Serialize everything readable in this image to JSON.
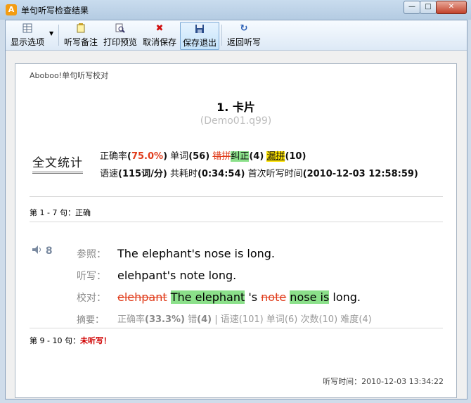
{
  "window": {
    "app_icon": "A",
    "title": "单句听写检查结果",
    "min_symbol": "—",
    "max_symbol": "□",
    "close_symbol": "✕"
  },
  "toolbar": {
    "show_options": "显示选项",
    "dictation_note": "听写备注",
    "print_preview": "打印预览",
    "cancel_save": "取消保存",
    "save_exit": "保存退出",
    "return_dictation": "返回听写",
    "icons": {
      "show_options": "grid-icon",
      "dictation_note": "note-icon",
      "print_preview": "magnifier-icon",
      "cancel_save": "red-x-icon",
      "save_exit": "floppy-disk-icon",
      "return_dictation": "refresh-icon"
    }
  },
  "report": {
    "brand": "Aboboo!单句听写校对",
    "title": "1. 卡片",
    "file": "(Demo01.q99)",
    "stats_label": "全文统计",
    "stats": {
      "accuracy_label": "正确率",
      "accuracy_open": "(",
      "accuracy_value": "75.0%",
      "accuracy_close": ")",
      "words_label": "单词",
      "words_value": "(56)",
      "misspell": "错拼",
      "corrected": "纠正",
      "corrected_value": "(4)",
      "missed": "漏拼",
      "missed_value": "(10)",
      "speed_label": "语速",
      "speed_value": "(115词/分)",
      "time_label": "共耗时",
      "time_value": "(0:34:54)",
      "first_label": "首次听写时间",
      "first_value": "(2010-12-03 12:58:59)"
    },
    "range1": "第 1 - 7 句：正确",
    "sentence": {
      "speaker_icon": "speaker-icon",
      "number": "8",
      "ref_label": "参照：",
      "ref_text": "The elephant's nose is long.",
      "dict_label": "听写：",
      "dict_text": "elehpant's note long.",
      "check_label": "校对：",
      "check": {
        "wrong1": "elehpant",
        "fix1": "The elephant",
        "mid": " 's ",
        "wrong2": "note",
        "fix2": "nose is",
        "end": " long."
      },
      "summary_label": "摘要：",
      "summary": {
        "acc_label": "正确率",
        "acc_value": "(33.3%)",
        "err_label": "错",
        "err_value": "(4)",
        "sep": " | ",
        "speed_label": "语速",
        "speed_value": "(101)",
        "words_label": "单词",
        "words_value": "(6)",
        "count_label": "次数",
        "count_value": "(10)",
        "diff_label": "难度",
        "diff_value": "(4)"
      }
    },
    "range2_prefix": "第 9 - 10 句：",
    "range2_status": "未听写！",
    "dictation_time_label": "听写时间：",
    "dictation_time_value": "2010-12-03 13:34:22"
  }
}
